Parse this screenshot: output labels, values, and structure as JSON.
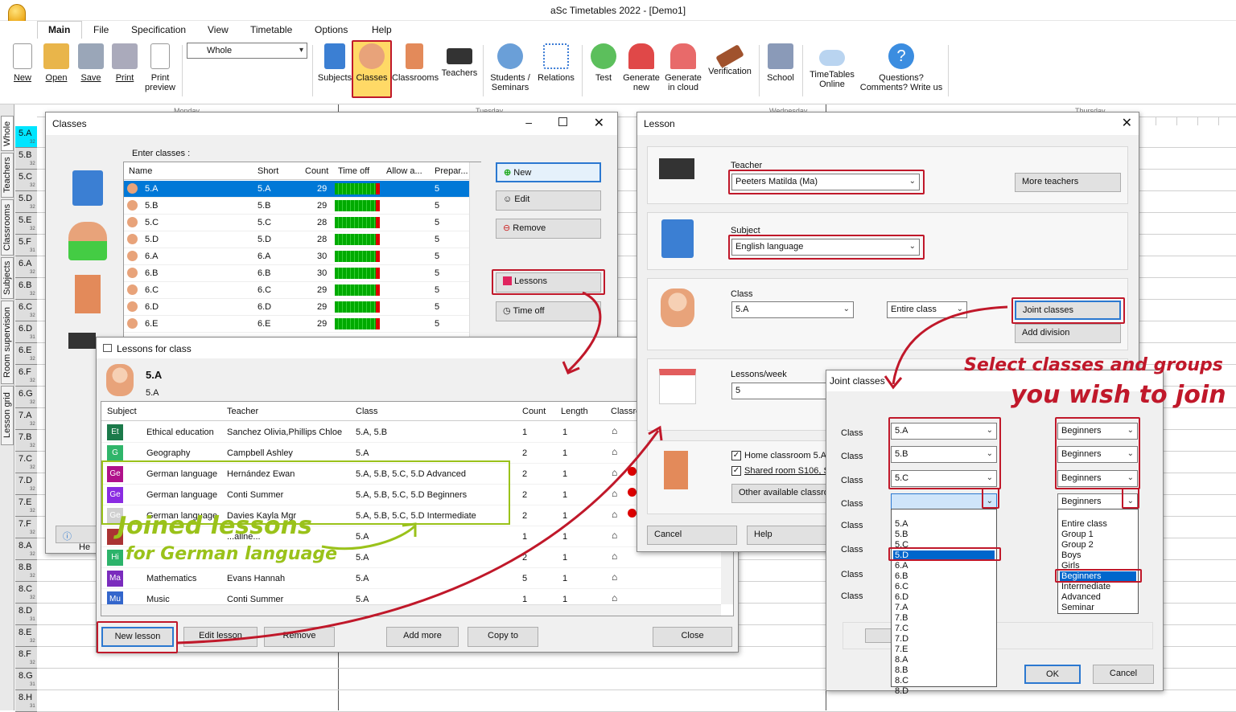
{
  "app": {
    "title": "aSc Timetables 2022  - [Demo1]"
  },
  "menu": [
    "Main",
    "File",
    "Specification",
    "View",
    "Timetable",
    "Options",
    "Help"
  ],
  "ribbon": {
    "new": "New",
    "open": "Open",
    "save": "Save",
    "print": "Print",
    "print_preview": "Print\npreview",
    "view_select": "Whole",
    "subjects": "Subjects",
    "classes": "Classes",
    "classrooms": "Classrooms",
    "teachers": "Teachers",
    "students": "Students /\nSeminars",
    "relations": "Relations",
    "test": "Test",
    "generate_new": "Generate\nnew",
    "generate_cloud": "Generate\nin cloud",
    "verification": "Verification",
    "school": "School",
    "online": "TimeTables\nOnline",
    "questions": "Questions?\nComments? Write us"
  },
  "grid": {
    "days": [
      "Monday",
      "Tuesday",
      "Wednesday",
      "Thursday"
    ],
    "rows": [
      "5.A",
      "5.B",
      "5.C",
      "5.D",
      "5.E",
      "5.F",
      "6.A",
      "6.B",
      "6.C",
      "6.D",
      "6.E",
      "6.F",
      "6.G",
      "7.A",
      "7.B",
      "7.C",
      "7.D",
      "7.E",
      "7.F",
      "8.A",
      "8.B",
      "8.C",
      "8.D",
      "8.E",
      "8.F",
      "8.G",
      "8.H"
    ],
    "counts": [
      "32",
      "32",
      "32",
      "32",
      "32",
      "31",
      "32",
      "32",
      "32",
      "31",
      "32",
      "32",
      "32",
      "32",
      "32",
      "32",
      "32",
      "32",
      "32",
      "32",
      "32",
      "32",
      "31",
      "32",
      "32",
      "31",
      "31"
    ],
    "vtabs": [
      "Whole",
      "Teachers",
      "Classrooms",
      "Subjects",
      "Room supervision",
      "Lesson grid"
    ]
  },
  "classes_win": {
    "title": "Classes",
    "enter": "Enter classes :",
    "cols": [
      "Name",
      "Short",
      "Count",
      "Time off",
      "Allow a...",
      "Prepar..."
    ],
    "rows": [
      [
        "5.A",
        "5.A",
        "29",
        "5"
      ],
      [
        "5.B",
        "5.B",
        "29",
        "5"
      ],
      [
        "5.C",
        "5.C",
        "28",
        "5"
      ],
      [
        "5.D",
        "5.D",
        "28",
        "5"
      ],
      [
        "6.A",
        "6.A",
        "30",
        "5"
      ],
      [
        "6.B",
        "6.B",
        "30",
        "5"
      ],
      [
        "6.C",
        "6.C",
        "29",
        "5"
      ],
      [
        "6.D",
        "6.D",
        "29",
        "5"
      ],
      [
        "6.E",
        "6.E",
        "29",
        "5"
      ]
    ],
    "btn_new": "New",
    "btn_edit": "Edit",
    "btn_remove": "Remove",
    "btn_lessons": "Lessons",
    "btn_timeoff": "Time off",
    "help_partial": "He"
  },
  "lessons_win": {
    "title": "Lessons for class",
    "class_big": "5.A",
    "class_small": "5.A",
    "cols": [
      "Subject",
      "Teacher",
      "Class",
      "Count",
      "Length",
      "Classro"
    ],
    "rows": [
      {
        "abbr": "Et",
        "color": "#1b7a4a",
        "subject": "Ethical education",
        "teacher": "Sanchez Olivia,Phillips Chloe",
        "class": "5.A, 5.B",
        "count": "1",
        "length": "1"
      },
      {
        "abbr": "G",
        "color": "#2fb56a",
        "subject": "Geography",
        "teacher": "Campbell Ashley",
        "class": "5.A",
        "count": "2",
        "length": "1"
      },
      {
        "abbr": "Ge",
        "color": "#b0108a",
        "subject": "German language",
        "teacher": "Hernández Ewan",
        "class": "5.A, 5.B, 5.C, 5.D Advanced",
        "count": "2",
        "length": "1"
      },
      {
        "abbr": "Ge",
        "color": "#8a2be2",
        "subject": "German language",
        "teacher": "Conti Summer",
        "class": "5.A, 5.B, 5.C, 5.D Beginners",
        "count": "2",
        "length": "1"
      },
      {
        "abbr": "Ge",
        "color": "#d0d0d0",
        "subject": "German language",
        "teacher": "Davies Kayla Mgr",
        "class": "5.A, 5.B, 5.C, 5.D Intermediate",
        "count": "2",
        "length": "1"
      },
      {
        "abbr": "",
        "color": "#a33",
        "subject": "",
        "teacher": "...allne...",
        "class": "5.A",
        "count": "1",
        "length": "1"
      },
      {
        "abbr": "Hi",
        "color": "#2cb36a",
        "subject": "",
        "teacher": "",
        "class": "5.A",
        "count": "2",
        "length": "1"
      },
      {
        "abbr": "Ma",
        "color": "#7a2bbd",
        "subject": "Mathematics",
        "teacher": "Evans Hannah",
        "class": "5.A",
        "count": "5",
        "length": "1"
      },
      {
        "abbr": "Mu",
        "color": "#36c",
        "subject": "Music",
        "teacher": "Conti Summer",
        "class": "5.A",
        "count": "1",
        "length": "1"
      }
    ],
    "btn_new": "New lesson",
    "btn_edit": "Edit lesson",
    "btn_remove": "Remove",
    "btn_addmore": "Add more",
    "btn_copy": "Copy to",
    "btn_close": "Close"
  },
  "lesson_win": {
    "title": "Lesson",
    "teacher_lbl": "Teacher",
    "teacher_val": "Peeters Matilda (Ma)",
    "more_teachers": "More teachers",
    "subject_lbl": "Subject",
    "subject_val": "English language",
    "class_lbl": "Class",
    "class_val": "5.A",
    "entire": "Entire class",
    "joint": "Joint classes",
    "add_div": "Add division",
    "lpw_lbl": "Lessons/week",
    "lpw_val": "5",
    "home_room": "Home classroom 5.A",
    "shared_room": "Shared room S106, S",
    "other_rooms": "Other available classroo",
    "cancel": "Cancel",
    "help": "Help"
  },
  "joint_win": {
    "title": "Joint classes",
    "class_lbl": "Class",
    "sel_classes": [
      "5.A",
      "5.B",
      "5.C",
      ""
    ],
    "sel_groups": [
      "Beginners",
      "Beginners",
      "Beginners",
      "Beginners"
    ],
    "class_list": [
      "5.A",
      "5.B",
      "5.C",
      "5.D",
      "6.A",
      "6.B",
      "6.C",
      "6.D",
      "7.A",
      "7.B",
      "7.C",
      "7.D",
      "7.E",
      "8.A",
      "8.B",
      "8.C",
      "8.D"
    ],
    "class_selected": "5.D",
    "group_list": [
      "Entire class",
      "Group 1",
      "Group 2",
      "Boys",
      "Girls",
      "Beginners",
      "Intermediate",
      "Advanced",
      "Seminar"
    ],
    "group_selected": "Beginners",
    "ok": "OK",
    "cancel": "Cancel"
  },
  "annotations": {
    "joined_1": "Joined lessons",
    "joined_2": "for German language",
    "select_1": "Select classes and groups",
    "select_2": "you wish to join"
  },
  "colors": {
    "accent_red": "#c0182a",
    "annot_green": "#9ac21a",
    "selection_blue": "#0066cc",
    "cyan": "#00e5ff"
  }
}
